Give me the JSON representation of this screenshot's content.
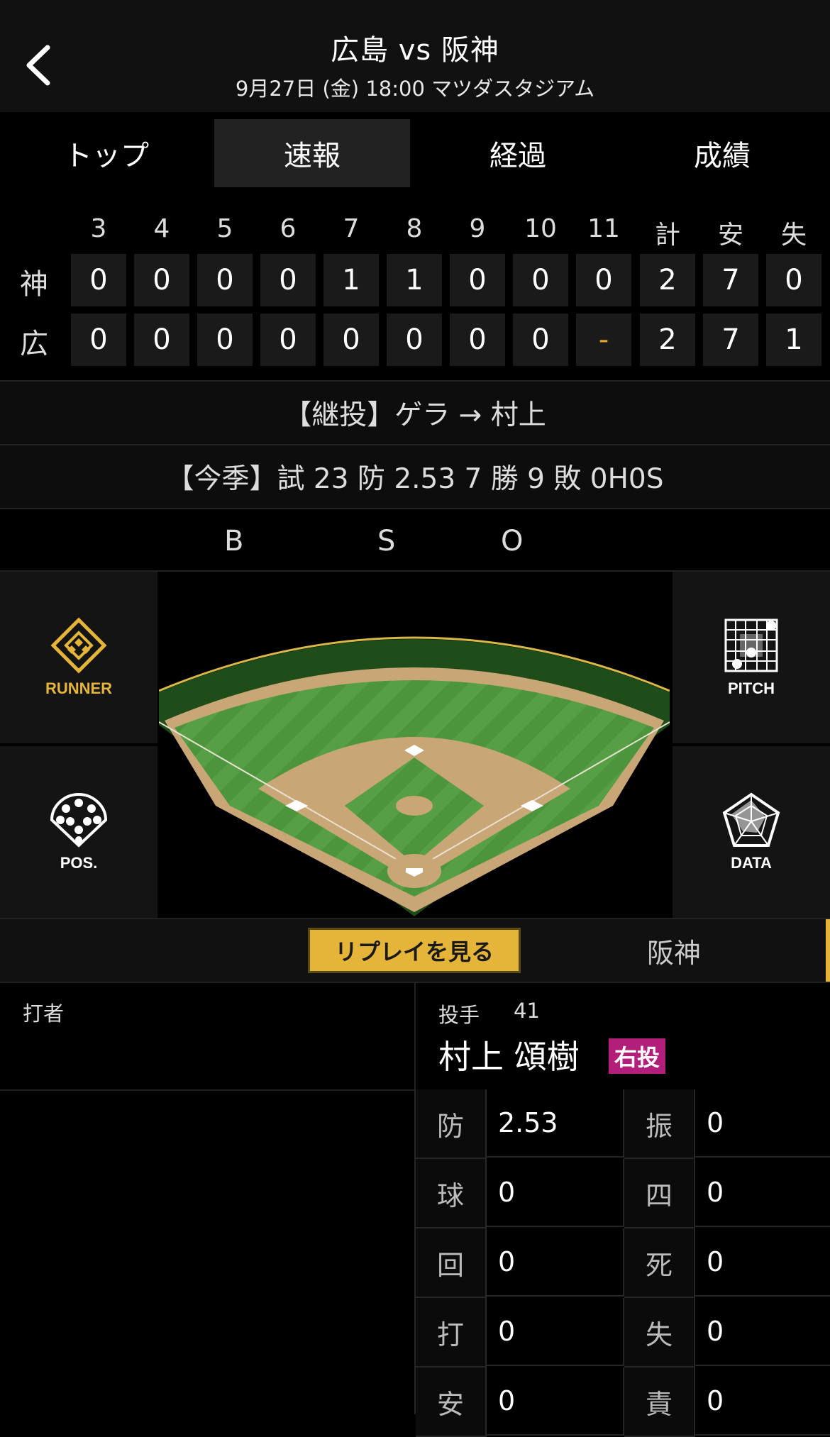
{
  "header": {
    "title": "広島 vs 阪神",
    "subtitle": "9月27日 (金) 18:00 マツダスタジアム",
    "back_icon": "chevron-left-icon"
  },
  "tabs": [
    {
      "label": "トップ",
      "active": false
    },
    {
      "label": "速報",
      "active": true
    },
    {
      "label": "経過",
      "active": false
    },
    {
      "label": "成績",
      "active": false
    }
  ],
  "scoreboard": {
    "columns": [
      "3",
      "4",
      "5",
      "6",
      "7",
      "8",
      "9",
      "10",
      "11",
      "計",
      "安",
      "失"
    ],
    "rows": [
      {
        "team": "神",
        "cells": [
          "0",
          "0",
          "0",
          "0",
          "1",
          "1",
          "0",
          "0",
          "0",
          "2",
          "7",
          "0"
        ]
      },
      {
        "team": "広",
        "cells": [
          "0",
          "0",
          "0",
          "0",
          "0",
          "0",
          "0",
          "0",
          "-",
          "2",
          "7",
          "1"
        ]
      }
    ]
  },
  "relief_info": "【継投】ゲラ → 村上",
  "season_info": "【今季】試 23 防 2.53 7 勝 9 敗 0H0S",
  "count": {
    "b_label": "B",
    "s_label": "S",
    "o_label": "O"
  },
  "side_buttons": {
    "runner": "RUNNER",
    "pitch": "PITCH",
    "pos": "POS.",
    "data": "DATA"
  },
  "replay": {
    "button_label": "リプレイを見る",
    "team_tab": "阪神"
  },
  "batter": {
    "heading": "打者"
  },
  "pitcher": {
    "role_label": "投手",
    "number": "41",
    "name": "村上 頌樹",
    "throws_badge": "右投"
  },
  "pitcher_stats": [
    {
      "k1": "防",
      "v1": "2.53",
      "k2": "振",
      "v2": "0"
    },
    {
      "k1": "球",
      "v1": "0",
      "k2": "四",
      "v2": "0"
    },
    {
      "k1": "回",
      "v1": "0",
      "k2": "死",
      "v2": "0"
    },
    {
      "k1": "打",
      "v1": "0",
      "k2": "失",
      "v2": "0"
    },
    {
      "k1": "安",
      "v1": "0",
      "k2": "責",
      "v2": "0"
    }
  ],
  "colors": {
    "accent": "#e5b53a",
    "dash": "#e5a32b",
    "badge": "#b21f7a",
    "field_green": "#4f9a3f",
    "dirt": "#c9a676"
  }
}
